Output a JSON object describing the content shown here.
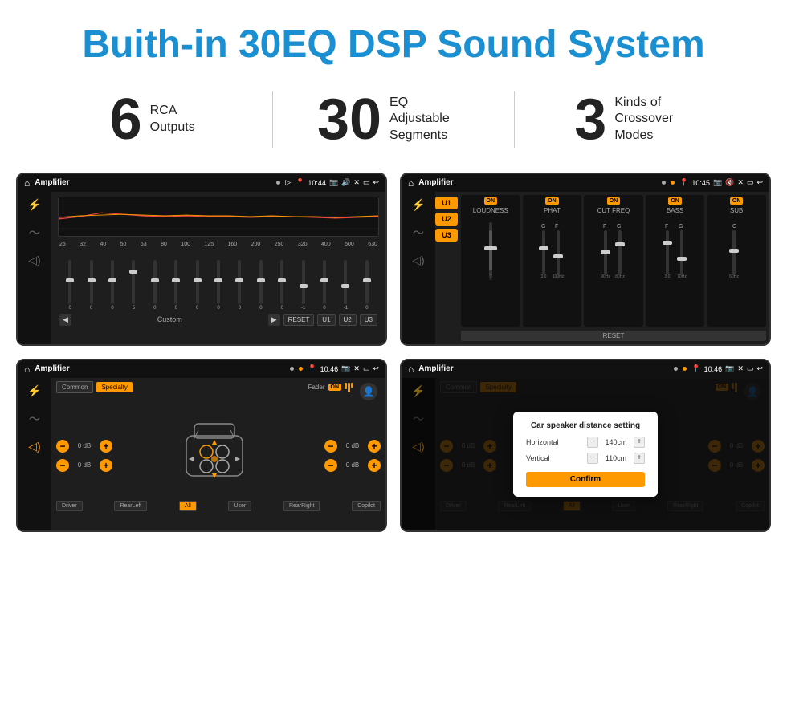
{
  "header": {
    "title": "Buith-in 30EQ DSP Sound System"
  },
  "stats": [
    {
      "number": "6",
      "text": "RCA\nOutputs"
    },
    {
      "number": "30",
      "text": "EQ Adjustable\nSegments"
    },
    {
      "number": "3",
      "text": "Kinds of\nCrossover Modes"
    }
  ],
  "screens": {
    "eq_screen": {
      "app_name": "Amplifier",
      "time": "10:44",
      "freqs": [
        "25",
        "32",
        "40",
        "50",
        "63",
        "80",
        "100",
        "125",
        "160",
        "200",
        "250",
        "320",
        "400",
        "500",
        "630"
      ],
      "values": [
        "0",
        "0",
        "0",
        "5",
        "0",
        "0",
        "0",
        "0",
        "0",
        "0",
        "0",
        "-1",
        "0",
        "-1"
      ],
      "buttons": [
        "Custom",
        "RESET",
        "U1",
        "U2",
        "U3"
      ]
    },
    "crossover_screen": {
      "app_name": "Amplifier",
      "time": "10:45",
      "presets": [
        "U1",
        "U2",
        "U3"
      ],
      "channels": [
        "LOUDNESS",
        "PHAT",
        "CUT FREQ",
        "BASS",
        "SUB"
      ],
      "reset_label": "RESET"
    },
    "balance_screen": {
      "app_name": "Amplifier",
      "time": "10:46",
      "fader_label": "Fader",
      "on_label": "ON",
      "common_label": "Common",
      "specialty_label": "Specialty",
      "vol_controls": [
        {
          "value": "0 dB"
        },
        {
          "value": "0 dB"
        },
        {
          "value": "0 dB"
        },
        {
          "value": "0 dB"
        }
      ],
      "buttons": [
        "Driver",
        "RearLeft",
        "All",
        "User",
        "RearRight",
        "Copilot"
      ]
    },
    "dialog_screen": {
      "app_name": "Amplifier",
      "time": "10:46",
      "dialog": {
        "title": "Car speaker distance setting",
        "horizontal_label": "Horizontal",
        "horizontal_value": "140cm",
        "vertical_label": "Vertical",
        "vertical_value": "110cm",
        "confirm_label": "Confirm"
      },
      "vol_right": [
        "0 dB",
        "0 dB"
      ],
      "buttons": [
        "Driver",
        "RearLeft",
        "All",
        "User",
        "RearRight",
        "Copilot"
      ]
    }
  }
}
